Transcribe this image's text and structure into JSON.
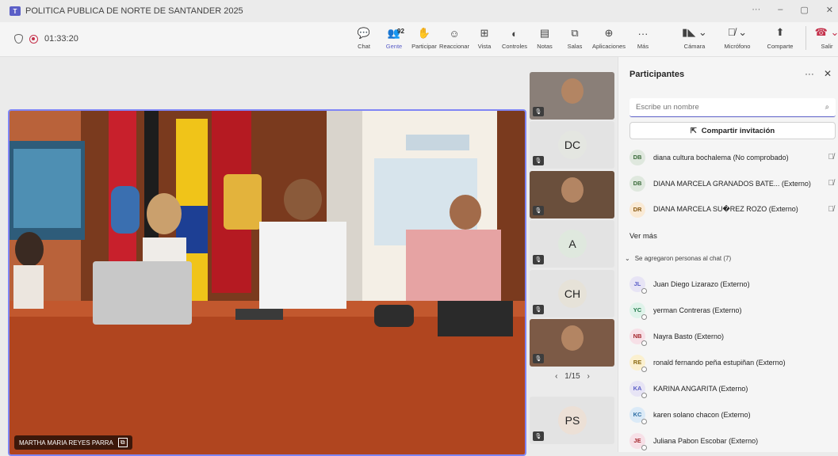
{
  "window": {
    "title": "POLITICA PUBLICA DE NORTE DE SANTANDER 2025",
    "controls": [
      "···",
      "–",
      "▢",
      "✕"
    ]
  },
  "toolbar": {
    "timer": "01:33:20",
    "tools": [
      {
        "label": "Chat",
        "icon": "chat-icon",
        "glyph": "💬"
      },
      {
        "label": "Gente",
        "icon": "people-icon",
        "glyph": "👥",
        "badge": "92"
      },
      {
        "label": "Participar",
        "icon": "raise-hand-icon",
        "glyph": "✋"
      },
      {
        "label": "Reaccionar",
        "icon": "react-icon",
        "glyph": "☺"
      },
      {
        "label": "Vista",
        "icon": "view-icon",
        "glyph": "⊞"
      },
      {
        "label": "Controles",
        "icon": "controls-icon",
        "glyph": "◐"
      },
      {
        "label": "Notas",
        "icon": "notes-icon",
        "glyph": "▤"
      },
      {
        "label": "Salas",
        "icon": "rooms-icon",
        "glyph": "⧉"
      },
      {
        "label": "Aplicaciones",
        "icon": "apps-icon",
        "glyph": "⊕"
      },
      {
        "label": "Más",
        "icon": "more-icon",
        "glyph": "···"
      }
    ],
    "camera_label": "Cámara",
    "mic_label": "Micrófono",
    "share_label": "Comparte",
    "leave_label": "Salir"
  },
  "stage": {
    "speaker_name": "MARTHA MARIA REYES PARRA",
    "pager": "1/15"
  },
  "thumbnails": [
    {
      "kind": "video"
    },
    {
      "kind": "avatar",
      "initials": "DC",
      "color": "#e4e6e1"
    },
    {
      "kind": "video"
    },
    {
      "kind": "avatar",
      "initials": "A",
      "color": "#dfe8de"
    },
    {
      "kind": "avatar",
      "initials": "CH",
      "color": "#e6e2d8"
    },
    {
      "kind": "video"
    },
    {
      "kind": "avatar",
      "initials": "PS",
      "color": "#ece0d6"
    }
  ],
  "panel": {
    "title": "Participantes",
    "search_placeholder": "Escribe un nombre",
    "invite_label": "Compartir invitación",
    "ver_mas": "Ver más",
    "section_label": "Se agregaron personas al chat (7)",
    "in_meeting": [
      {
        "initials": "DB",
        "name": "diana cultura bochalema (No comprobado)",
        "bg": "#dfe8de",
        "fg": "#3b6b3b"
      },
      {
        "initials": "DB",
        "name": "DIANA MARCELA GRANADOS BATE... (Externo)",
        "bg": "#dfe8de",
        "fg": "#3b6b3b"
      },
      {
        "initials": "DR",
        "name": "DIANA MARCELA SU�REZ ROZO (Externo)",
        "bg": "#faead5",
        "fg": "#8a5a12"
      }
    ],
    "chat_added": [
      {
        "initials": "JL",
        "name": "Juan Diego Lizarazo (Externo)",
        "bg": "#e7e4f5",
        "fg": "#5b5fc7"
      },
      {
        "initials": "YC",
        "name": "yerman Contreras (Externo)",
        "bg": "#dff3ea",
        "fg": "#217a4a"
      },
      {
        "initials": "NB",
        "name": "Nayra Basto (Externo)",
        "bg": "#f7e0e7",
        "fg": "#a4262c"
      },
      {
        "initials": "RE",
        "name": "ronald fernando peña estupiñan (Externo)",
        "bg": "#fbf0cf",
        "fg": "#8a6a12"
      },
      {
        "initials": "KA",
        "name": "KARINA ANGARITA (Externo)",
        "bg": "#e7e4f5",
        "fg": "#5b5fc7"
      },
      {
        "initials": "KC",
        "name": "karen solano chacon (Externo)",
        "bg": "#dbeaf7",
        "fg": "#2b6ca3"
      },
      {
        "initials": "JE",
        "name": "Juliana Pabon Escobar (Externo)",
        "bg": "#f7e0e7",
        "fg": "#a4262c"
      }
    ]
  }
}
